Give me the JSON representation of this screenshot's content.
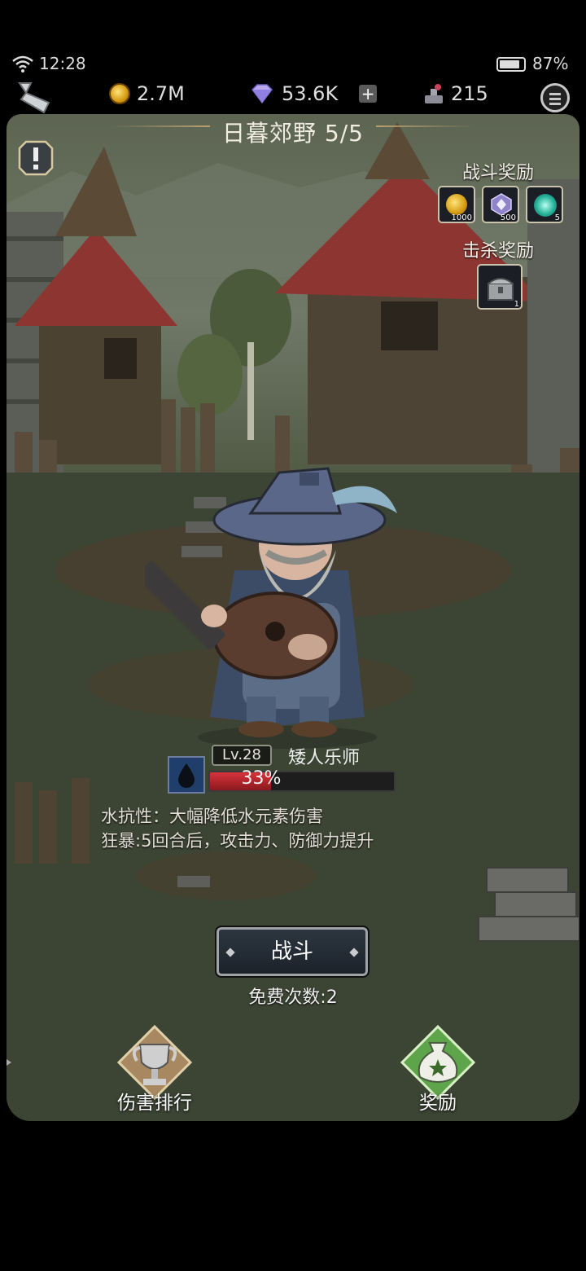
{
  "status": {
    "time": "12:28",
    "battery": "87%"
  },
  "resources": {
    "gold": "2.7M",
    "diamonds": "53.6K",
    "potions": "215"
  },
  "stage": {
    "title": "日暮郊野 5/5"
  },
  "battle_rewards": {
    "label": "战斗奖励",
    "items": [
      {
        "icon": "gold-coin-icon",
        "count": "1000"
      },
      {
        "icon": "crystal-icon",
        "count": "500"
      },
      {
        "icon": "teal-orb-icon",
        "count": "5"
      }
    ]
  },
  "kill_rewards": {
    "label": "击杀奖励",
    "items": [
      {
        "icon": "treasure-chest-icon",
        "count": "1"
      }
    ]
  },
  "boss": {
    "level": "Lv.28",
    "name": "矮人乐师",
    "element": "water",
    "hp_percent": 33,
    "hp_text": "33%",
    "traits": [
      "水抗性：大幅降低水元素伤害",
      "狂暴:5回合后，攻击力、防御力提升"
    ]
  },
  "fight": {
    "label": "战斗",
    "free_attempts": "免费次数:2"
  },
  "bottom": {
    "ranking_label": "伤害排行",
    "reward_label": "奖励"
  },
  "colors": {
    "hp_red": "#d8333b",
    "water_blue": "#1f3e6b",
    "reward_green": "#5ea44a"
  }
}
